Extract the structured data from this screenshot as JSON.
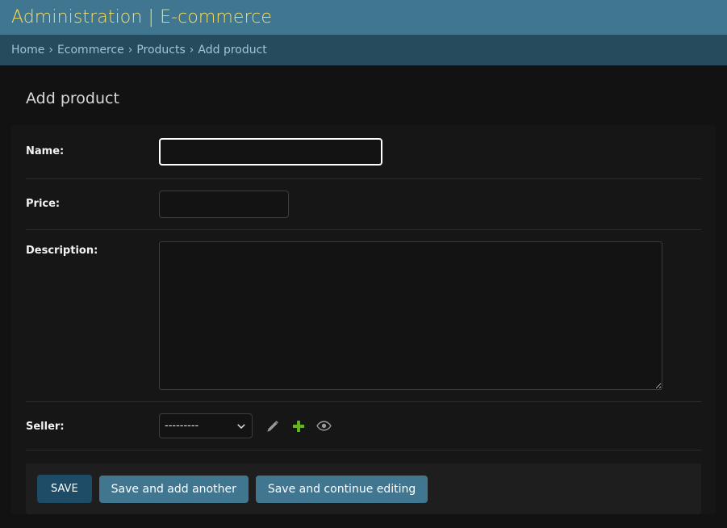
{
  "header": {
    "site_title": "Administration | E-commerce",
    "brand_color": "#417690",
    "title_color": "#f5dd5d"
  },
  "breadcrumbs": {
    "separator": "›",
    "items": [
      {
        "label": "Home",
        "current": false
      },
      {
        "label": "Ecommerce",
        "current": false
      },
      {
        "label": "Products",
        "current": false
      },
      {
        "label": "Add product",
        "current": true
      }
    ],
    "background_color": "#264b5d",
    "text_color": "#9fc4d8"
  },
  "main": {
    "page_title": "Add product",
    "form": {
      "rows": [
        {
          "label": "Name:",
          "field_id": "id_name",
          "type": "text",
          "value": "",
          "focused": true
        },
        {
          "label": "Price:",
          "field_id": "id_price",
          "type": "text",
          "value": "",
          "focused": false
        },
        {
          "label": "Description:",
          "field_id": "id_description",
          "type": "textarea",
          "value": "",
          "focused": false
        },
        {
          "label": "Seller:",
          "field_id": "id_seller",
          "type": "select",
          "value": "---------",
          "focused": false
        }
      ],
      "seller_options": [
        "---------"
      ],
      "related_widgets": [
        {
          "name": "change-related",
          "icon": "pencil-icon",
          "color": "#999999"
        },
        {
          "name": "add-related",
          "icon": "plus-icon",
          "color": "#62b71a"
        },
        {
          "name": "view-related",
          "icon": "eye-icon",
          "color": "#999999"
        }
      ]
    },
    "submit_row": {
      "save_label": "SAVE",
      "save_add_another_label": "Save and add another",
      "save_continue_label": "Save and continue editing",
      "primary_color": "#1e4c66",
      "secondary_color": "#417690"
    }
  }
}
